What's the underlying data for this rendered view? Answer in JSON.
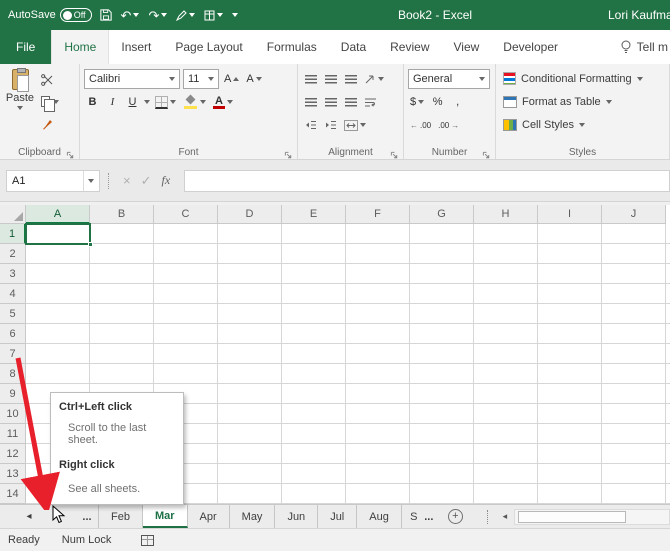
{
  "title_bar": {
    "autosave_label": "AutoSave",
    "autosave_state": "Off",
    "document_title": "Book2  -  Excel",
    "user_name": "Lori Kaufman"
  },
  "ribbon": {
    "tabs": [
      "File",
      "Home",
      "Insert",
      "Page Layout",
      "Formulas",
      "Data",
      "Review",
      "View",
      "Developer"
    ],
    "active_tab": "Home",
    "tell_me": "Tell m",
    "clipboard": {
      "label": "Clipboard",
      "paste": "Paste"
    },
    "font": {
      "label": "Font",
      "name": "Calibri",
      "size": "11",
      "bold": "B",
      "italic": "I",
      "underline": "U",
      "grow": "A",
      "shrink": "A",
      "color_letter": "A"
    },
    "alignment": {
      "label": "Alignment"
    },
    "number": {
      "label": "Number",
      "format": "General",
      "currency": "$",
      "percent": "%",
      "comma": ",",
      "decimal": ".00"
    },
    "styles": {
      "label": "Styles",
      "conditional_formatting": "Conditional Formatting",
      "format_as_table": "Format as Table",
      "cell_styles": "Cell Styles"
    }
  },
  "formula_bar": {
    "name_box": "A1",
    "fx": "fx",
    "value": ""
  },
  "grid": {
    "columns": [
      "A",
      "B",
      "C",
      "D",
      "E",
      "F",
      "G",
      "H",
      "I",
      "J"
    ],
    "rows": [
      "1",
      "2",
      "3",
      "4",
      "5",
      "6",
      "7",
      "8",
      "9",
      "10",
      "11",
      "12",
      "13",
      "14"
    ],
    "selected_cell": "A1"
  },
  "tooltip": {
    "title1": "Ctrl+Left click",
    "body1": "Scroll to the last sheet.",
    "title2": "Right click",
    "body2": "See all sheets."
  },
  "sheet_bar": {
    "overflow_left": "...",
    "tabs": [
      "Feb",
      "Mar",
      "Apr",
      "May",
      "Jun",
      "Jul",
      "Aug",
      "S"
    ],
    "active_tab": "Mar",
    "overflow_right": "..."
  },
  "status_bar": {
    "ready": "Ready",
    "num_lock": "Num Lock"
  }
}
